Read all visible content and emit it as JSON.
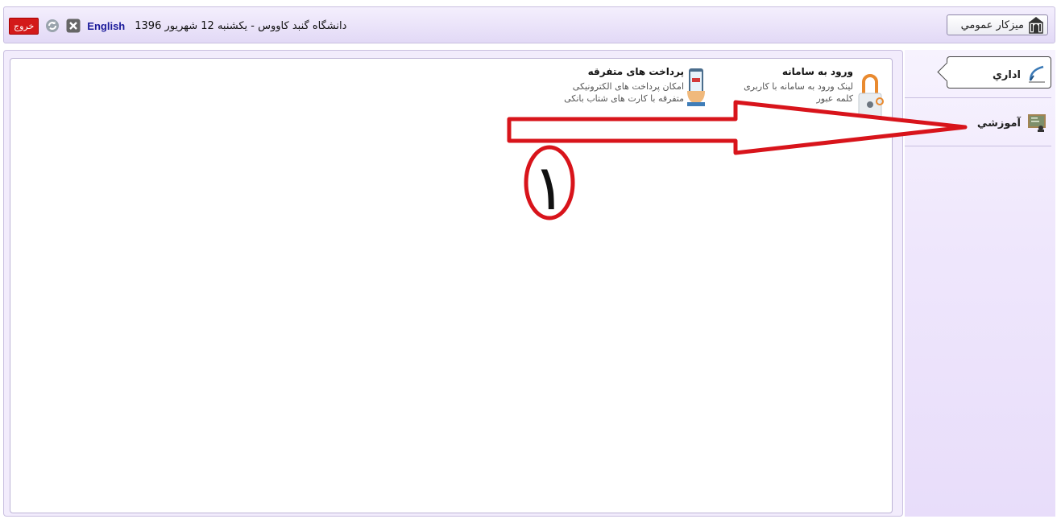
{
  "header": {
    "home_label": "ميزکار عمومي",
    "logout_label": "خروج",
    "english_label": "English",
    "date_text": "دانشگاه گنبد کاووس - یکشنبه 12 شهریور 1396"
  },
  "sidebar": {
    "items": [
      {
        "label": "اداري",
        "icon": "pen-icon",
        "active": true
      },
      {
        "label": "آموزشي",
        "icon": "classroom-icon",
        "active": false
      }
    ]
  },
  "cards": [
    {
      "title": "ورود به سامانه",
      "lines": [
        "لینک ورود به سامانه با کاربری",
        "کلمه عبور"
      ],
      "icon": "lock-icon"
    },
    {
      "title": "پرداخت های متفرقه",
      "lines": [
        "امکان پرداخت های الکترونیکی",
        "متفرقه با کارت های شتاب بانکی"
      ],
      "icon": "mobile-payment-icon"
    }
  ],
  "annotation": {
    "number": "١",
    "arrow_color": "#d8141b"
  }
}
